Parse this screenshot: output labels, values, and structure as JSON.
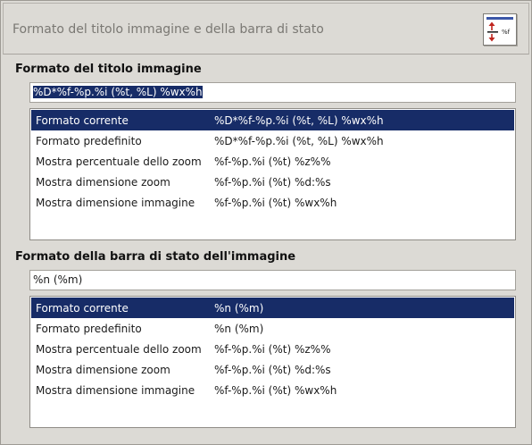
{
  "header": {
    "title": "Formato del titolo immagine e della barra di stato",
    "icon": "title-format-icon"
  },
  "title_section": {
    "label": "Formato del titolo immagine",
    "entry_value": "%D*%f-%p.%i (%t, %L) %wx%h",
    "rows": [
      {
        "name": "Formato corrente",
        "format": "%D*%f-%p.%i (%t, %L) %wx%h",
        "selected": true
      },
      {
        "name": "Formato predefinito",
        "format": "%D*%f-%p.%i (%t, %L) %wx%h",
        "selected": false
      },
      {
        "name": "Mostra percentuale dello zoom",
        "format": "%f-%p.%i (%t) %z%%",
        "selected": false
      },
      {
        "name": "Mostra dimensione zoom",
        "format": "%f-%p.%i (%t) %d:%s",
        "selected": false
      },
      {
        "name": "Mostra dimensione immagine",
        "format": "%f-%p.%i (%t) %wx%h",
        "selected": false
      }
    ]
  },
  "status_section": {
    "label": "Formato della barra di stato dell'immagine",
    "entry_value": "%n (%m)",
    "rows": [
      {
        "name": "Formato corrente",
        "format": "%n (%m)",
        "selected": true
      },
      {
        "name": "Formato predefinito",
        "format": "%n (%m)",
        "selected": false
      },
      {
        "name": "Mostra percentuale dello zoom",
        "format": "%f-%p.%i (%t) %z%%",
        "selected": false
      },
      {
        "name": "Mostra dimensione zoom",
        "format": "%f-%p.%i (%t) %d:%s",
        "selected": false
      },
      {
        "name": "Mostra dimensione immagine",
        "format": "%f-%p.%i (%t) %wx%h",
        "selected": false
      }
    ]
  },
  "colors": {
    "selection": "#172c67",
    "background": "#dcdad5"
  }
}
